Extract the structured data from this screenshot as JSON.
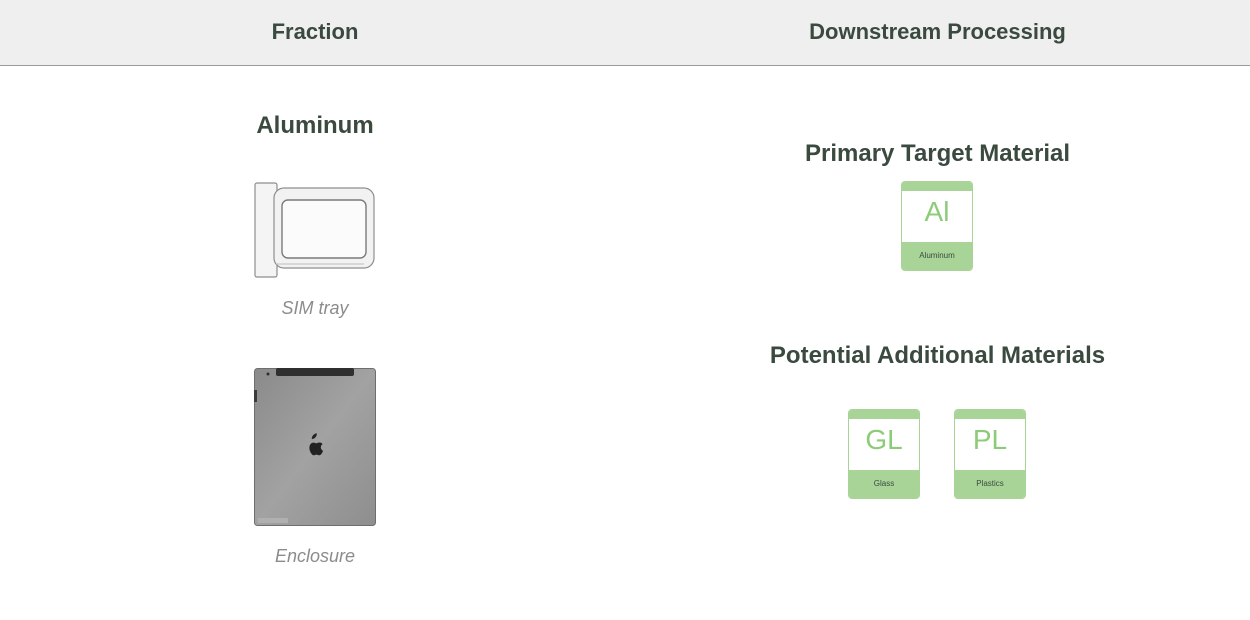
{
  "header": {
    "left": "Fraction",
    "right": "Downstream Processing"
  },
  "fraction": {
    "title": "Aluminum",
    "items": [
      {
        "caption": "SIM tray",
        "icon": "sim-tray-image"
      },
      {
        "caption": "Enclosure",
        "icon": "enclosure-image"
      }
    ]
  },
  "processing": {
    "primary_title": "Primary Target Material",
    "primary_tiles": [
      {
        "symbol": "Al",
        "name": "Aluminum"
      }
    ],
    "additional_title": "Potential Additional Materials",
    "additional_tiles": [
      {
        "symbol": "GL",
        "name": "Glass"
      },
      {
        "symbol": "PL",
        "name": "Plastics"
      }
    ]
  },
  "colors": {
    "header_bg": "#efefef",
    "heading_text": "#3a4a3f",
    "caption_text": "#8c8c8c",
    "tile_green": "#a8d498",
    "tile_symbol": "#8ccc78"
  }
}
